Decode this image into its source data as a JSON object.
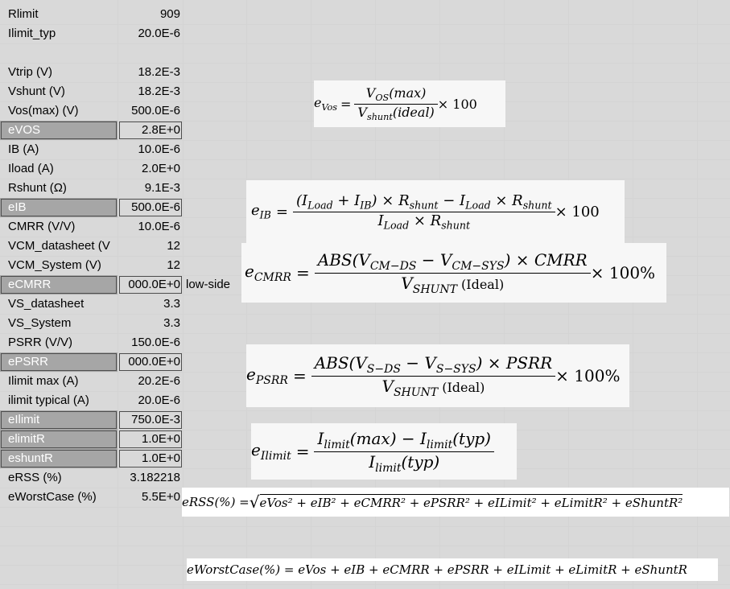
{
  "rows": [
    {
      "label": "Rlimit",
      "value": "909",
      "hl": false
    },
    {
      "label": "Ilimit_typ",
      "value": "20.0E-6",
      "hl": false
    },
    {
      "label": "",
      "value": "",
      "hl": false
    },
    {
      "label": "Vtrip (V)",
      "value": "18.2E-3",
      "hl": false
    },
    {
      "label": "Vshunt (V)",
      "value": "18.2E-3",
      "hl": false
    },
    {
      "label": "Vos(max) (V)",
      "value": "500.0E-6",
      "hl": false
    },
    {
      "label": "eVOS",
      "value": "2.8E+0",
      "hl": true
    },
    {
      "label": "IB (A)",
      "value": "10.0E-6",
      "hl": false
    },
    {
      "label": "Iload (A)",
      "value": "2.0E+0",
      "hl": false
    },
    {
      "label": "Rshunt (Ω)",
      "value": "9.1E-3",
      "hl": false
    },
    {
      "label": "eIB",
      "value": "500.0E-6",
      "hl": true
    },
    {
      "label": "CMRR (V/V)",
      "value": "10.0E-6",
      "hl": false
    },
    {
      "label": "VCM_datasheet (V",
      "value": "12",
      "hl": false
    },
    {
      "label": "VCM_System (V)",
      "value": "12",
      "hl": false
    },
    {
      "label": "eCMRR",
      "value": "000.0E+0",
      "hl": true,
      "note": "low-side"
    },
    {
      "label": "VS_datasheet",
      "value": "3.3",
      "hl": false
    },
    {
      "label": "VS_System",
      "value": "3.3",
      "hl": false
    },
    {
      "label": "PSRR (V/V)",
      "value": "150.0E-6",
      "hl": false
    },
    {
      "label": "ePSRR",
      "value": "000.0E+0",
      "hl": true
    },
    {
      "label": "Ilimit max (A)",
      "value": "20.2E-6",
      "hl": false
    },
    {
      "label": "ilimit typical (A)",
      "value": "20.0E-6",
      "hl": false
    },
    {
      "label": "eIlimit",
      "value": "750.0E-3",
      "hl": true
    },
    {
      "label": "elimitR",
      "value": "1.0E+0",
      "hl": true
    },
    {
      "label": "eshuntR",
      "value": "1.0E+0",
      "hl": true
    },
    {
      "label": "eRSS (%)",
      "value": "3.182218",
      "hl": false
    },
    {
      "label": "eWorstCase (%)",
      "value": "5.5E+0",
      "hl": false
    }
  ],
  "formulas": {
    "evos": {
      "lhs": "e",
      "lhs_sub": "Vos",
      "num": "V",
      "num_sub": "OS",
      "num_tail": "(max)",
      "den": "V",
      "den_sub": "shunt",
      "den_tail": "(ideal)",
      "mult": "× 100"
    },
    "eib": {
      "lhs": "e",
      "lhs_sub": "IB",
      "num": "(I_Load + I_IB) × R_shunt − I_Load × R_shunt",
      "den": "I_Load × R_shunt",
      "mult": "× 100"
    },
    "ecmrr": {
      "lhs": "e",
      "lhs_sub": "CMRR",
      "num_a": "ABS(V",
      "num_sub1": "CM−DS",
      "num_b": " − V",
      "num_sub2": "CM−SYS",
      "num_c": ") × CMRR",
      "den": "V",
      "den_sub": "SHUNT",
      "den_tail": " (Ideal)",
      "mult": "× 100%"
    },
    "epsrr": {
      "lhs": "e",
      "lhs_sub": "PSRR",
      "num_a": "ABS(V",
      "num_sub1": "S−DS",
      "num_b": " − V",
      "num_sub2": "S−SYS",
      "num_c": ") × PSRR",
      "den": "V",
      "den_sub": "SHUNT",
      "den_tail": " (Ideal)",
      "mult": "× 100%"
    },
    "eilimit": {
      "lhs": "e",
      "lhs_sub": "Ilimit",
      "num_a": "I",
      "num_sub1": "limit",
      "num_b": "(max) − I",
      "num_sub2": "limit",
      "num_c": "(typ)",
      "den": "I",
      "den_sub": "limit",
      "den_tail": "(typ)"
    },
    "erss": {
      "text_lhs": "eRSS(%) = ",
      "text_rhs": "eVos² + eIB² + eCMRR² + ePSRR² + eILimit² + eLimitR² + eShuntR²"
    },
    "eworst": {
      "text": "eWorstCase(%) = eVos + eIB + eCMRR + ePSRR + eILimit + eLimitR + eShuntR"
    }
  }
}
